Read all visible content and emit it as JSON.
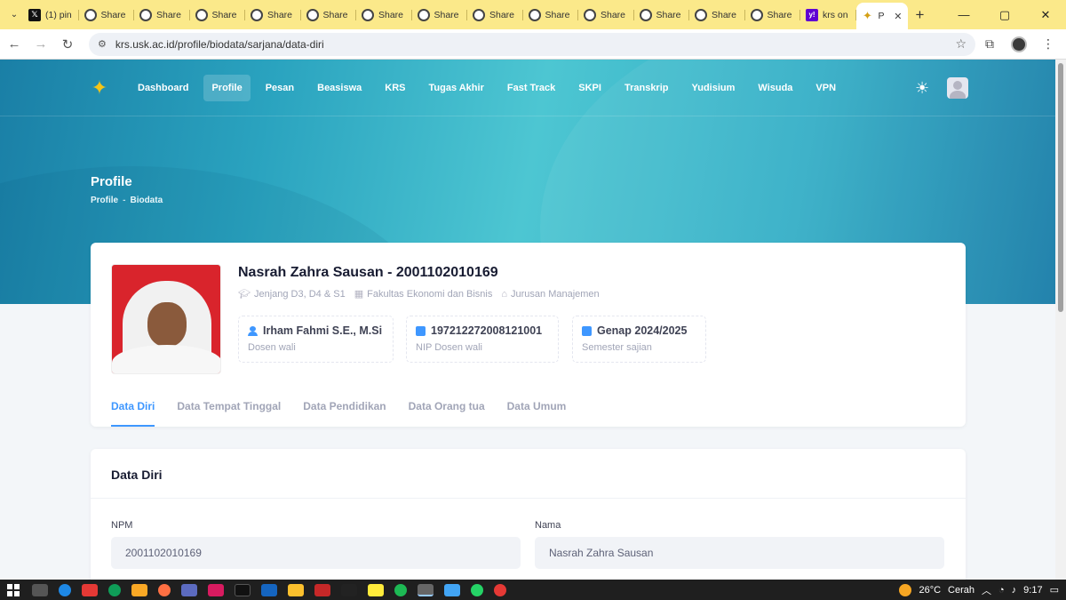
{
  "browser": {
    "tabs": [
      {
        "label": "(1) pin",
        "fav": "x"
      },
      {
        "label": "Share",
        "fav": "share"
      },
      {
        "label": "Share",
        "fav": "share"
      },
      {
        "label": "Share",
        "fav": "share"
      },
      {
        "label": "Share",
        "fav": "share"
      },
      {
        "label": "Share",
        "fav": "share"
      },
      {
        "label": "Share",
        "fav": "share"
      },
      {
        "label": "Share",
        "fav": "share"
      },
      {
        "label": "Share",
        "fav": "share"
      },
      {
        "label": "Share",
        "fav": "share"
      },
      {
        "label": "Share",
        "fav": "share"
      },
      {
        "label": "Share",
        "fav": "share"
      },
      {
        "label": "Share",
        "fav": "share"
      },
      {
        "label": "Share",
        "fav": "share"
      },
      {
        "label": "krs on",
        "fav": "yahoo"
      }
    ],
    "active_tab": {
      "label": "P",
      "icon": "university-logo-icon"
    },
    "url": "krs.usk.ac.id/profile/biodata/sarjana/data-diri"
  },
  "nav": {
    "items": [
      "Dashboard",
      "Profile",
      "Pesan",
      "Beasiswa",
      "KRS",
      "Tugas Akhir",
      "Fast Track",
      "SKPI",
      "Transkrip",
      "Yudisium",
      "Wisuda",
      "VPN"
    ],
    "active": "Profile"
  },
  "header": {
    "title": "Profile",
    "breadcrumb": [
      "Profile",
      "Biodata"
    ]
  },
  "profile": {
    "name": "Nasrah Zahra Sausan - 2001102010169",
    "meta": [
      {
        "icon": "graduation-cap-icon",
        "text": "Jenjang D3, D4 & S1"
      },
      {
        "icon": "building-icon",
        "text": "Fakultas Ekonomi dan Bisnis"
      },
      {
        "icon": "institution-icon",
        "text": "Jurusan Manajemen"
      }
    ],
    "stats": [
      {
        "icon": "person-icon",
        "value": "Irham Fahmi S.E., M.Si",
        "label": "Dosen wali"
      },
      {
        "icon": "id-card-icon",
        "value": "197212272008121001",
        "label": "NIP Dosen wali"
      },
      {
        "icon": "book-icon",
        "value": "Genap 2024/2025",
        "label": "Semester sajian"
      }
    ],
    "tabs": [
      "Data Diri",
      "Data Tempat Tinggal",
      "Data Pendidikan",
      "Data Orang tua",
      "Data Umum"
    ],
    "active_tab": "Data Diri"
  },
  "data_diri": {
    "title": "Data Diri",
    "fields": [
      {
        "label": "NPM",
        "value": "2001102010169"
      },
      {
        "label": "Nama",
        "value": "Nasrah Zahra Sausan"
      }
    ]
  },
  "taskbar": {
    "weather": "26°C",
    "weather_text": "Cerah",
    "time": "9:17"
  },
  "colors": {
    "accent": "#3e97ff",
    "hero_start": "#1a7fa6",
    "hero_mid": "#4dc6d2",
    "tabstrip": "#fbe98a"
  }
}
